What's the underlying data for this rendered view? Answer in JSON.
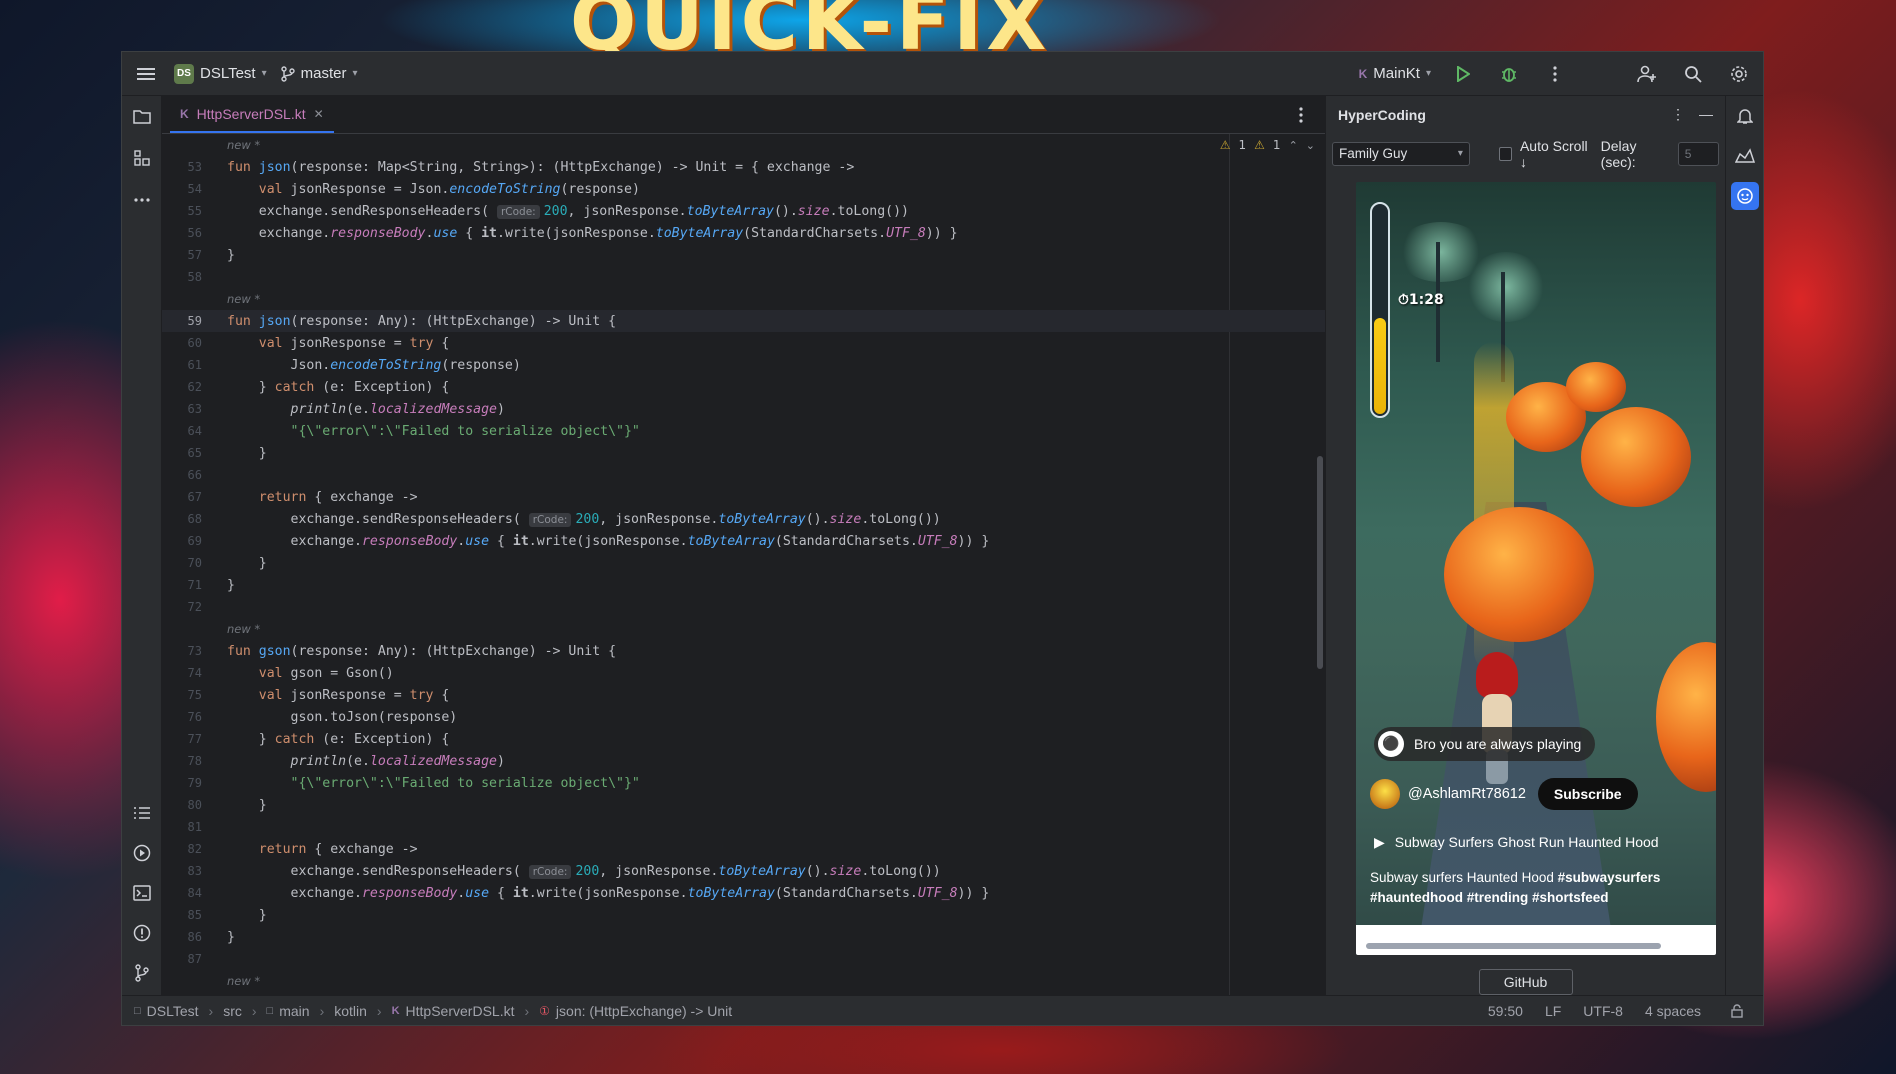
{
  "wallpaper": {
    "title": "QUICK-FIX"
  },
  "titlebar": {
    "project_badge": "DS",
    "project_name": "DSLTest",
    "branch": "master",
    "run_config": "MainKt"
  },
  "editor": {
    "tab_label": "HttpServerDSL.kt",
    "warnings": {
      "weak_count": "1",
      "strong_count": "1"
    },
    "lines": [
      {
        "type": "hint",
        "text": "new *"
      },
      {
        "n": "53",
        "html": "<span class='kw'>fun</span> <span class='fn'>json</span>(response: Map&lt;String, String&gt;): (HttpExchange) -&gt; Unit = { exchange -&gt;"
      },
      {
        "n": "54",
        "html": "    <span class='kw'>val</span> jsonResponse = Json.<span class='it'>encodeToString</span>(response)"
      },
      {
        "n": "55",
        "html": "    exchange.sendResponseHeaders( <span class='inl'>rCode:</span><span class='num'>200</span>, jsonResponse.<span class='it'>toByteArray</span>().<span class='prop'>size</span>.toLong())"
      },
      {
        "n": "56",
        "html": "    exchange.<span class='prop'>responseBody</span>.<span class='it'>use</span> { <b>it</b>.write(jsonResponse.<span class='it'>toByteArray</span>(StandardCharsets.<span class='prop'>UTF_8</span>)) }"
      },
      {
        "n": "57",
        "html": "}"
      },
      {
        "n": "58",
        "html": ""
      },
      {
        "type": "hint",
        "text": "new *"
      },
      {
        "n": "59",
        "cur": true,
        "html": "<span class='kw'>fun</span> <span class='fn'>json</span>(response: Any): (HttpExchange) -&gt; Unit {"
      },
      {
        "n": "60",
        "html": "    <span class='kw'>val</span> jsonResponse = <span class='kw'>try</span> {"
      },
      {
        "n": "61",
        "html": "        Json.<span class='it'>encodeToString</span>(response)"
      },
      {
        "n": "62",
        "html": "    } <span class='kw'>catch</span> (e: Exception) {"
      },
      {
        "n": "63",
        "html": "        <i>println</i>(e.<span class='prop'>localizedMessage</span>)"
      },
      {
        "n": "64",
        "html": "        <span class='str'>\"{\\\"error\\\":\\\"Failed to serialize object\\\"}\"</span>"
      },
      {
        "n": "65",
        "html": "    }"
      },
      {
        "n": "66",
        "html": ""
      },
      {
        "n": "67",
        "html": "    <span class='kw'>return</span> { exchange -&gt;"
      },
      {
        "n": "68",
        "html": "        exchange.sendResponseHeaders( <span class='inl'>rCode:</span><span class='num'>200</span>, jsonResponse.<span class='it'>toByteArray</span>().<span class='prop'>size</span>.toLong())"
      },
      {
        "n": "69",
        "html": "        exchange.<span class='prop'>responseBody</span>.<span class='it'>use</span> { <b>it</b>.write(jsonResponse.<span class='it'>toByteArray</span>(StandardCharsets.<span class='prop'>UTF_8</span>)) }"
      },
      {
        "n": "70",
        "html": "    }"
      },
      {
        "n": "71",
        "html": "}"
      },
      {
        "n": "72",
        "html": ""
      },
      {
        "type": "hint",
        "text": "new *"
      },
      {
        "n": "73",
        "html": "<span class='kw'>fun</span> <span class='fn'>gson</span>(response: Any): (HttpExchange) -&gt; Unit {"
      },
      {
        "n": "74",
        "html": "    <span class='kw'>val</span> gson = Gson()"
      },
      {
        "n": "75",
        "html": "    <span class='kw'>val</span> jsonResponse = <span class='kw'>try</span> {"
      },
      {
        "n": "76",
        "html": "        gson.toJson(response)"
      },
      {
        "n": "77",
        "html": "    } <span class='kw'>catch</span> (e: Exception) {"
      },
      {
        "n": "78",
        "html": "        <i>println</i>(e.<span class='prop'>localizedMessage</span>)"
      },
      {
        "n": "79",
        "html": "        <span class='str'>\"{\\\"error\\\":\\\"Failed to serialize object\\\"}\"</span>"
      },
      {
        "n": "80",
        "html": "    }"
      },
      {
        "n": "81",
        "html": ""
      },
      {
        "n": "82",
        "html": "    <span class='kw'>return</span> { exchange -&gt;"
      },
      {
        "n": "83",
        "html": "        exchange.sendResponseHeaders( <span class='inl'>rCode:</span><span class='num'>200</span>, jsonResponse.<span class='it'>toByteArray</span>().<span class='prop'>size</span>.toLong())"
      },
      {
        "n": "84",
        "html": "        exchange.<span class='prop'>responseBody</span>.<span class='it'>use</span> { <b>it</b>.write(jsonResponse.<span class='it'>toByteArray</span>(StandardCharsets.<span class='prop'>UTF_8</span>)) }"
      },
      {
        "n": "85",
        "html": "    }"
      },
      {
        "n": "86",
        "html": "}"
      },
      {
        "n": "87",
        "html": ""
      },
      {
        "type": "hint",
        "text": "new *"
      }
    ]
  },
  "panel": {
    "title": "HyperCoding",
    "dropdown_value": "Family Guy",
    "auto_scroll_label": "Auto Scroll ↓",
    "delay_label": "Delay (sec):",
    "delay_placeholder": "5",
    "video": {
      "timer": "1:28",
      "comment": "Bro you are always playing",
      "channel": "@AshlamRt78612",
      "subscribe": "Subscribe",
      "playlist": "Subway Surfers Ghost Run Haunted Hood",
      "desc_text": "Subway surfers Haunted Hood ",
      "desc_tags_1": "#subwaysurfers",
      "desc_tags_2": "#hauntedhood #trending #shortsfeed",
      "level": 0.45
    },
    "github_label": "GitHub"
  },
  "statusbar": {
    "crumbs": [
      "DSLTest",
      "src",
      "main",
      "kotlin",
      "HttpServerDSL.kt",
      "json: (HttpExchange) -> Unit"
    ],
    "position": "59:50",
    "line_sep": "LF",
    "encoding": "UTF-8",
    "indent": "4 spaces"
  },
  "colors": {
    "accent": "#3574f0",
    "keyword": "#cf8e6d",
    "function": "#56a8f5",
    "string": "#6aab73",
    "number": "#2aacb8",
    "property": "#c77dbb"
  }
}
